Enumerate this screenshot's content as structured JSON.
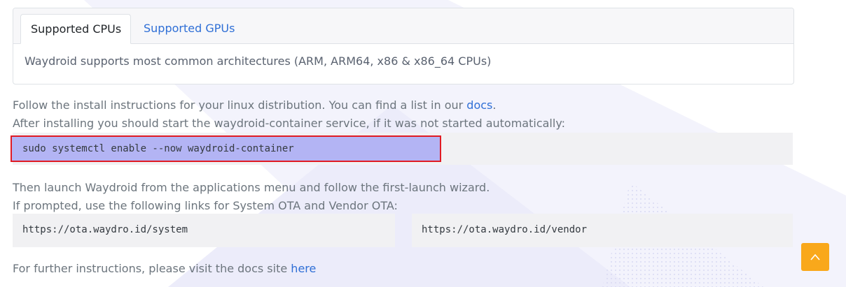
{
  "tabs": [
    {
      "label": "Supported CPUs",
      "active": true
    },
    {
      "label": "Supported GPUs",
      "active": false
    }
  ],
  "tab_content": "Waydroid supports most common architectures (ARM, ARM64, x86 & x86_64 CPUs)",
  "install": {
    "line1_text": "Follow the install instructions for your linux distribution. You can find a list in our ",
    "line1_link": "docs",
    "line1_end": ".",
    "line2": "After installing you should start the waydroid-container service, if it was not started automatically:",
    "command": "sudo systemctl enable --now waydroid-container"
  },
  "launch": {
    "line1": "Then launch Waydroid from the applications menu and follow the first-launch wizard.",
    "line2": "If prompted, use the following links for System OTA and Vendor OTA:",
    "system_ota": "https://ota.waydro.id/system",
    "vendor_ota": "https://ota.waydro.id/vendor"
  },
  "further": {
    "text": "For further instructions, please visit the docs site ",
    "link": "here"
  },
  "icons": {
    "scroll_top": "chevron-up-icon"
  },
  "colors": {
    "link": "#2f6fd6",
    "highlight_fill": "#b3b4f4",
    "highlight_border": "#e01b24",
    "scroll_button": "#f9a81b"
  }
}
